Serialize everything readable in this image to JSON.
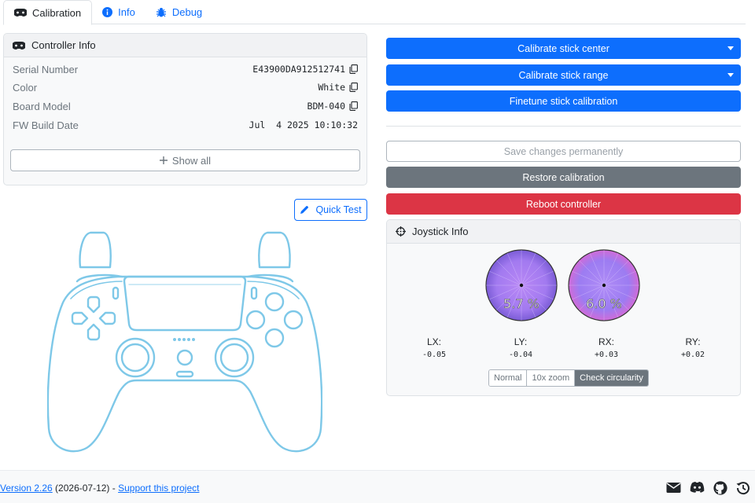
{
  "tabs": [
    {
      "label": "Calibration",
      "icon": "gamepad-icon",
      "active": true
    },
    {
      "label": "Info",
      "icon": "info-circle-icon",
      "active": false
    },
    {
      "label": "Debug",
      "icon": "bug-icon",
      "active": false
    }
  ],
  "controller_info": {
    "title": "Controller Info",
    "rows": [
      {
        "label": "Serial Number",
        "value": "E43900DA912512741"
      },
      {
        "label": "Color",
        "value": "White"
      },
      {
        "label": "Board Model",
        "value": "BDM-040"
      },
      {
        "label": "FW Build Date",
        "value": "Jul  4 2025 10:10:32"
      }
    ],
    "show_all_label": "Show all"
  },
  "quick_test_label": "Quick Test",
  "actions": {
    "calibrate_center": "Calibrate stick center",
    "calibrate_range": "Calibrate stick range",
    "finetune": "Finetune stick calibration",
    "save": "Save changes permanently",
    "restore": "Restore calibration",
    "reboot": "Reboot controller"
  },
  "joystick_info": {
    "title": "Joystick Info",
    "left_circularity": "5.7 %",
    "right_circularity": "6.0 %",
    "axes": [
      {
        "label": "LX:",
        "value": "-0.05"
      },
      {
        "label": "LY:",
        "value": "-0.04"
      },
      {
        "label": "RX:",
        "value": "+0.03"
      },
      {
        "label": "RY:",
        "value": "+0.02"
      }
    ],
    "modes": [
      {
        "label": "Normal",
        "active": false
      },
      {
        "label": "10x zoom",
        "active": false
      },
      {
        "label": "Check circularity",
        "active": true
      }
    ]
  },
  "footer": {
    "version_link": "Version 2.26",
    "date": " (2026-07-12) - ",
    "support_link": "Support this project",
    "icons": [
      "envelope-icon",
      "discord-icon",
      "github-icon",
      "history-icon"
    ]
  },
  "colors": {
    "primary": "#0d6efd",
    "secondary": "#6c757d",
    "danger": "#dc3545",
    "controller_outline": "#7ec8e8"
  }
}
